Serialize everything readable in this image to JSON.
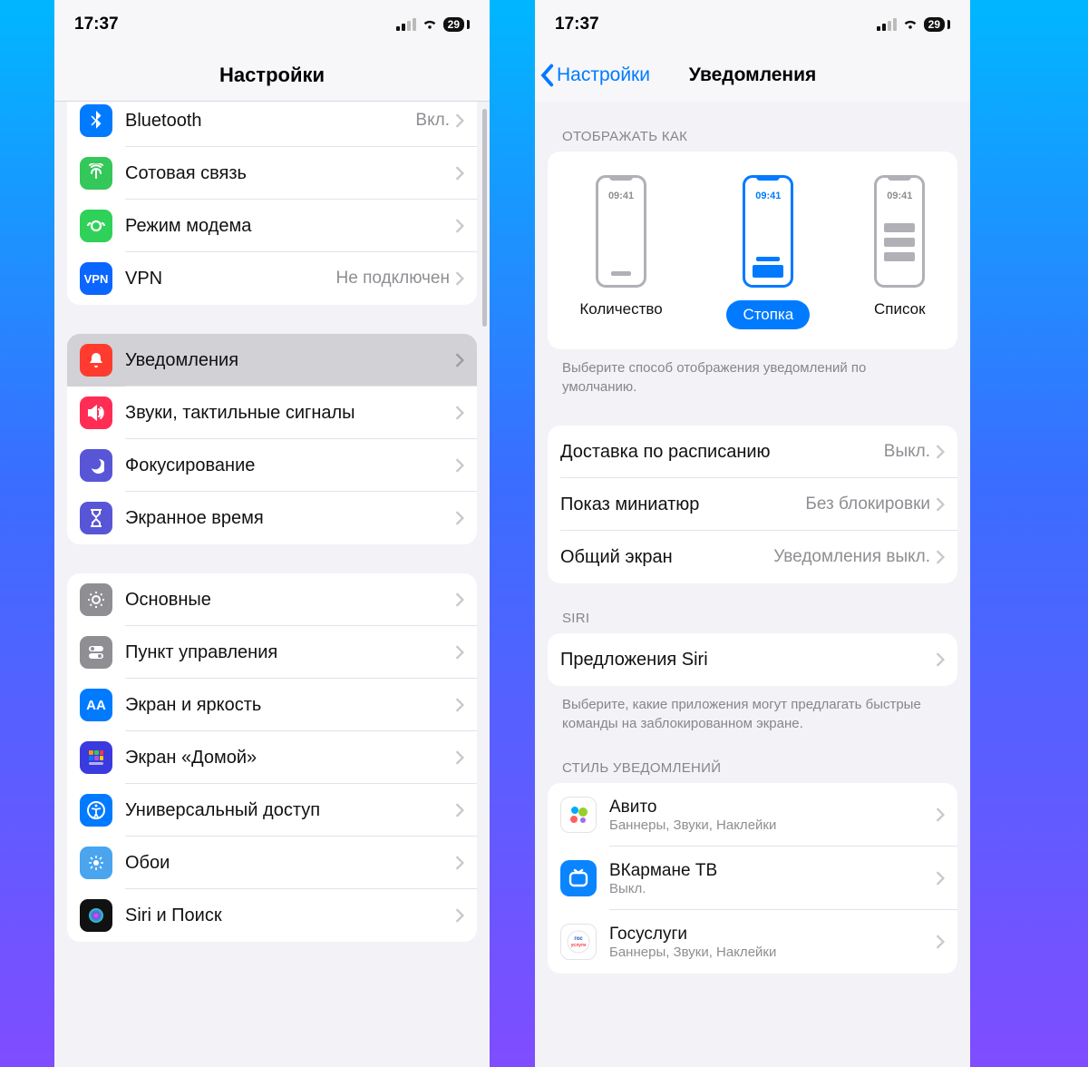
{
  "status": {
    "time": "17:37",
    "battery": "29"
  },
  "left": {
    "title": "Настройки",
    "groups": [
      {
        "items": [
          {
            "icon": "bluetooth",
            "label": "Bluetooth",
            "detail": "Вкл."
          },
          {
            "icon": "cellular",
            "label": "Сотовая связь",
            "detail": ""
          },
          {
            "icon": "hotspot",
            "label": "Режим модема",
            "detail": ""
          },
          {
            "icon": "vpn",
            "label": "VPN",
            "detail": "Не подключен"
          }
        ]
      },
      {
        "items": [
          {
            "icon": "bell",
            "label": "Уведомления",
            "detail": "",
            "selected": true
          },
          {
            "icon": "speaker",
            "label": "Звуки, тактильные сигналы",
            "detail": ""
          },
          {
            "icon": "moon",
            "label": "Фокусирование",
            "detail": ""
          },
          {
            "icon": "hourglass",
            "label": "Экранное время",
            "detail": ""
          }
        ]
      },
      {
        "items": [
          {
            "icon": "gear",
            "label": "Основные",
            "detail": ""
          },
          {
            "icon": "switches",
            "label": "Пункт управления",
            "detail": ""
          },
          {
            "icon": "aa",
            "label": "Экран и яркость",
            "detail": ""
          },
          {
            "icon": "grid",
            "label": "Экран «Домой»",
            "detail": ""
          },
          {
            "icon": "person",
            "label": "Универсальный доступ",
            "detail": ""
          },
          {
            "icon": "flower",
            "label": "Обои",
            "detail": ""
          },
          {
            "icon": "siri",
            "label": "Siri и Поиск",
            "detail": ""
          }
        ]
      }
    ]
  },
  "right": {
    "back": "Настройки",
    "title": "Уведомления",
    "displayAsHeader": "ОТОБРАЖАТЬ КАК",
    "displayAsFooter": "Выберите способ отображения уведомлений по умолчанию.",
    "displayAsClock": "09:41",
    "displayAsOptions": [
      {
        "label": "Количество",
        "selected": false,
        "kind": "count"
      },
      {
        "label": "Стопка",
        "selected": true,
        "kind": "stack"
      },
      {
        "label": "Список",
        "selected": false,
        "kind": "list"
      }
    ],
    "settings": [
      {
        "label": "Доставка по расписанию",
        "detail": "Выкл."
      },
      {
        "label": "Показ миниатюр",
        "detail": "Без блокировки"
      },
      {
        "label": "Общий экран",
        "detail": "Уведомления выкл."
      }
    ],
    "siriHeader": "SIRI",
    "siriRow": "Предложения Siri",
    "siriFooter": "Выберите, какие приложения могут предлагать быстрые команды на заблокированном экране.",
    "styleHeader": "СТИЛЬ УВЕДОМЛЕНИЙ",
    "apps": [
      {
        "name": "Авито",
        "sub": "Баннеры, Звуки, Наклейки",
        "icon": "avito"
      },
      {
        "name": "ВКармане ТВ",
        "sub": "Выкл.",
        "icon": "vkarmane"
      },
      {
        "name": "Госуслуги",
        "sub": "Баннеры, Звуки, Наклейки",
        "icon": "gosuslugi"
      }
    ]
  }
}
